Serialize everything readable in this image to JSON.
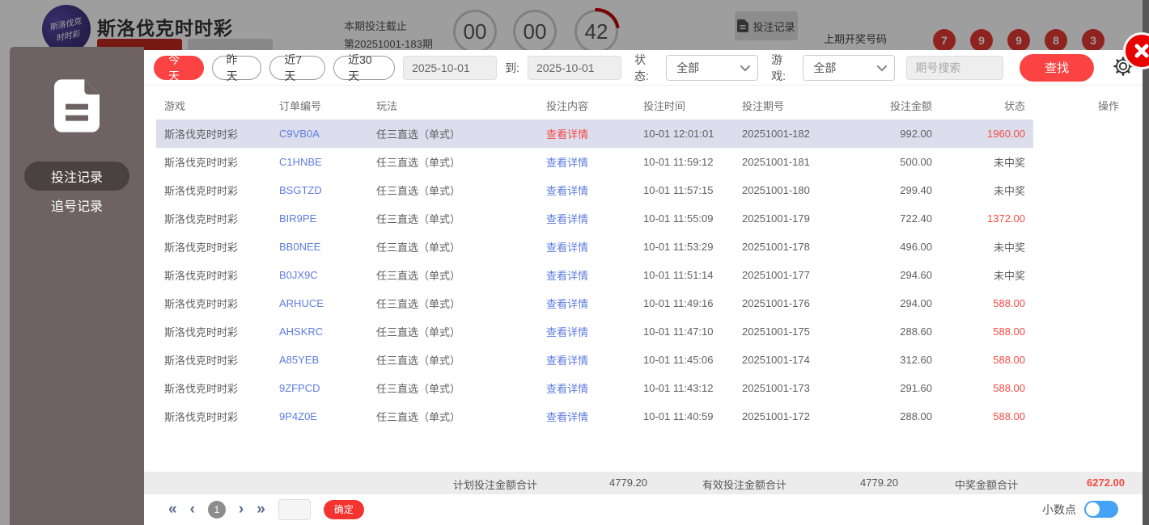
{
  "page_header": {
    "title": "斯洛伐克时时彩",
    "logo_line1": "斯洛伐克",
    "logo_line2": "时时彩",
    "deadline_label": "本期投注截止",
    "period_label": "第20251001-183期",
    "countdown": [
      "00",
      "00",
      "42"
    ],
    "bet_record_button": "投注记录",
    "last_draw_label": "上期开奖号码",
    "last_draw_numbers": [
      "7",
      "9",
      "9",
      "8",
      "3"
    ]
  },
  "sidebar": {
    "items": [
      {
        "label": "投注记录",
        "active": true
      },
      {
        "label": "追号记录",
        "active": false
      }
    ]
  },
  "filters": {
    "quick": [
      {
        "label": "今天",
        "active": true
      },
      {
        "label": "昨天",
        "active": false
      },
      {
        "label": "近7天",
        "active": false
      },
      {
        "label": "近30天",
        "active": false
      }
    ],
    "date_from": "2025-10-01",
    "to_label": "到:",
    "date_to": "2025-10-01",
    "status_label": "状态:",
    "status_value": "全部",
    "game_label": "游戏:",
    "game_value": "全部",
    "search_placeholder": "期号搜索",
    "search_button": "查找"
  },
  "table": {
    "headers": [
      "游戏",
      "订单编号",
      "玩法",
      "投注内容",
      "投注时间",
      "投注期号",
      "投注金额",
      "状态",
      "操作"
    ],
    "rows": [
      {
        "game": "斯洛伐克时时彩",
        "order": "C9VB0A",
        "play": "任三直选（单式）",
        "detail": "查看详情",
        "time": "10-01 12:01:01",
        "period": "20251001-182",
        "amount": "992.00",
        "status": "1960.00",
        "win": true,
        "highlighted": true,
        "detail_red": true
      },
      {
        "game": "斯洛伐克时时彩",
        "order": "C1HNBE",
        "play": "任三直选（单式）",
        "detail": "查看详情",
        "time": "10-01 11:59:12",
        "period": "20251001-181",
        "amount": "500.00",
        "status": "未中奖",
        "win": false,
        "highlighted": false,
        "detail_red": false
      },
      {
        "game": "斯洛伐克时时彩",
        "order": "BSGTZD",
        "play": "任三直选（单式）",
        "detail": "查看详情",
        "time": "10-01 11:57:15",
        "period": "20251001-180",
        "amount": "299.40",
        "status": "未中奖",
        "win": false,
        "highlighted": false,
        "detail_red": false
      },
      {
        "game": "斯洛伐克时时彩",
        "order": "BIR9PE",
        "play": "任三直选（单式）",
        "detail": "查看详情",
        "time": "10-01 11:55:09",
        "period": "20251001-179",
        "amount": "722.40",
        "status": "1372.00",
        "win": true,
        "highlighted": false,
        "detail_red": false
      },
      {
        "game": "斯洛伐克时时彩",
        "order": "BB0NEE",
        "play": "任三直选（单式）",
        "detail": "查看详情",
        "time": "10-01 11:53:29",
        "period": "20251001-178",
        "amount": "496.00",
        "status": "未中奖",
        "win": false,
        "highlighted": false,
        "detail_red": false
      },
      {
        "game": "斯洛伐克时时彩",
        "order": "B0JX9C",
        "play": "任三直选（单式）",
        "detail": "查看详情",
        "time": "10-01 11:51:14",
        "period": "20251001-177",
        "amount": "294.60",
        "status": "未中奖",
        "win": false,
        "highlighted": false,
        "detail_red": false
      },
      {
        "game": "斯洛伐克时时彩",
        "order": "ARHUCE",
        "play": "任三直选（单式）",
        "detail": "查看详情",
        "time": "10-01 11:49:16",
        "period": "20251001-176",
        "amount": "294.00",
        "status": "588.00",
        "win": true,
        "highlighted": false,
        "detail_red": false
      },
      {
        "game": "斯洛伐克时时彩",
        "order": "AHSKRC",
        "play": "任三直选（单式）",
        "detail": "查看详情",
        "time": "10-01 11:47:10",
        "period": "20251001-175",
        "amount": "288.60",
        "status": "588.00",
        "win": true,
        "highlighted": false,
        "detail_red": false
      },
      {
        "game": "斯洛伐克时时彩",
        "order": "A85YEB",
        "play": "任三直选（单式）",
        "detail": "查看详情",
        "time": "10-01 11:45:06",
        "period": "20251001-174",
        "amount": "312.60",
        "status": "588.00",
        "win": true,
        "highlighted": false,
        "detail_red": false
      },
      {
        "game": "斯洛伐克时时彩",
        "order": "9ZFPCD",
        "play": "任三直选（单式）",
        "detail": "查看详情",
        "time": "10-01 11:43:12",
        "period": "20251001-173",
        "amount": "291.60",
        "status": "588.00",
        "win": true,
        "highlighted": false,
        "detail_red": false
      },
      {
        "game": "斯洛伐克时时彩",
        "order": "9P4Z0E",
        "play": "任三直选（单式）",
        "detail": "查看详情",
        "time": "10-01 11:40:59",
        "period": "20251001-172",
        "amount": "288.00",
        "status": "588.00",
        "win": true,
        "highlighted": false,
        "detail_red": false
      }
    ]
  },
  "summary": {
    "plan_label": "计划投注金额合计",
    "plan_value": "4779.20",
    "valid_label": "有效投注金额合计",
    "valid_value": "4779.20",
    "win_label": "中奖金额合计",
    "win_value": "6272.00"
  },
  "pagination": {
    "current_page": "1",
    "goto_value": "",
    "confirm_label": "确定",
    "decimal_label": "小数点"
  },
  "colors": {
    "accent_red": "#fb4343",
    "link_blue": "#5e7ce0",
    "win_red": "#f34a42",
    "highlight_row": "#dcdeee",
    "toggle_blue": "#45a2f5",
    "ball_red": "#e53935",
    "sidebar_bg": "#6e6263"
  }
}
